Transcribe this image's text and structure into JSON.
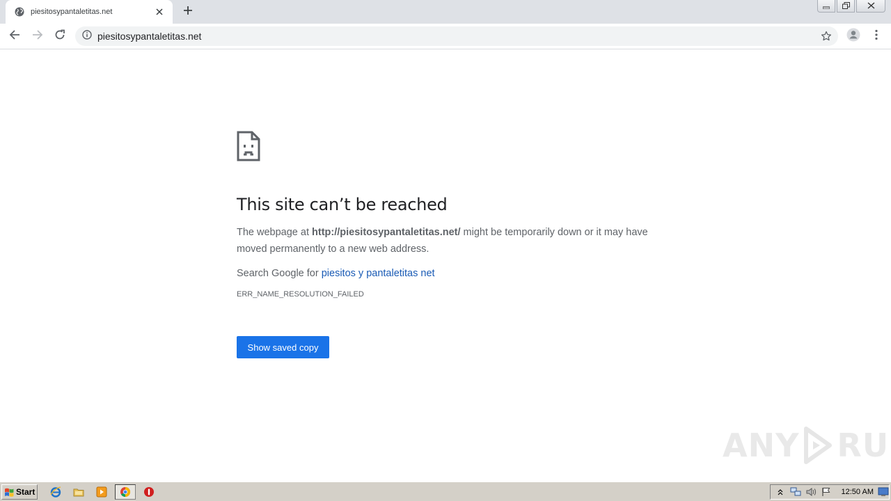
{
  "browser": {
    "tab": {
      "title": "piesitosypantaletitas.net",
      "favicon": "globe-icon",
      "close_icon": "close-icon"
    },
    "new_tab_icon": "plus-icon",
    "window_controls": [
      "minimize-icon",
      "restore-icon",
      "close-icon"
    ],
    "toolbar": {
      "back_icon": "back-arrow-icon",
      "forward_icon": "forward-arrow-icon",
      "reload_icon": "reload-icon",
      "address": "piesitosypantaletitas.net",
      "info_icon": "info-icon",
      "bookmark_icon": "star-icon",
      "profile_icon": "avatar-icon",
      "menu_icon": "kebab-menu-icon"
    }
  },
  "error_page": {
    "icon": "sad-page-icon",
    "title": "This site can’t be reached",
    "desc_prefix": "The webpage at ",
    "desc_url": "http://piesitosypantaletitas.net/",
    "desc_suffix": " might be temporarily down or it may have moved permanently to a new web address.",
    "search_prefix": "Search Google for ",
    "search_link": "piesitos y pantaletitas net",
    "error_code": "ERR_NAME_RESOLUTION_FAILED",
    "button_label": "Show saved copy",
    "accent_color": "#1a73e8",
    "link_color": "#1a5bb5"
  },
  "watermark": {
    "left": "ANY",
    "right": "RUN"
  },
  "taskbar": {
    "start_label": "Start",
    "quick_launch": [
      "ie-icon",
      "folder-icon",
      "media-player-icon",
      "chrome-icon",
      "stop-icon"
    ],
    "tray_icons": [
      "chevron-up-icon",
      "network-icon",
      "volume-icon",
      "flag-icon",
      "desktop-icon"
    ],
    "clock": "12:50 AM"
  }
}
